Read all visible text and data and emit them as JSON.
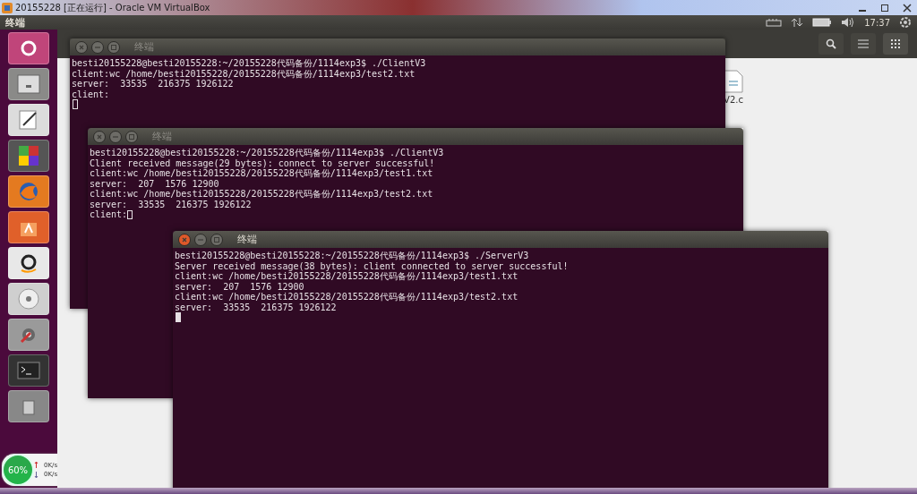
{
  "host_window": {
    "title": "20155228 [正在运行] - Oracle VM VirtualBox"
  },
  "top_panel": {
    "app_name": "终端",
    "clock": "17:37"
  },
  "file_manager": {
    "files": [
      {
        "name": "V2.c"
      }
    ]
  },
  "terminals": [
    {
      "title": "终端",
      "active": false,
      "cursor_on_new_line": true,
      "lines": [
        "besti20155228@besti20155228:~/20155228代码备份/1114exp3$ ./ClientV3",
        "client:wc /home/besti20155228/20155228代码备份/1114exp3/test2.txt",
        "server:  33535  216375 1926122",
        "client:"
      ]
    },
    {
      "title": "终端",
      "active": false,
      "cursor_on_new_line": false,
      "lines": [
        "besti20155228@besti20155228:~/20155228代码备份/1114exp3$ ./ClientV3",
        "Client received message(29 bytes): connect to server successful!",
        "client:wc /home/besti20155228/20155228代码备份/1114exp3/test1.txt",
        "server:  207  1576 12900",
        "client:wc /home/besti20155228/20155228代码备份/1114exp3/test2.txt",
        "server:  33535  216375 1926122",
        "client:"
      ]
    },
    {
      "title": "终端",
      "active": true,
      "cursor_on_new_line": true,
      "lines": [
        "besti20155228@besti20155228:~/20155228代码备份/1114exp3$ ./ServerV3",
        "Server received message(38 bytes): client connected to server successful!",
        "client:wc /home/besti20155228/20155228代码备份/1114exp3/test1.txt",
        "server:  207  1576 12900",
        "client:wc /home/besti20155228/20155228代码备份/1114exp3/test2.txt",
        "server:  33535  216375 1926122"
      ]
    }
  ],
  "speed_widget": {
    "percent": "60%",
    "upload": "0K/s",
    "download": "0K/s"
  }
}
